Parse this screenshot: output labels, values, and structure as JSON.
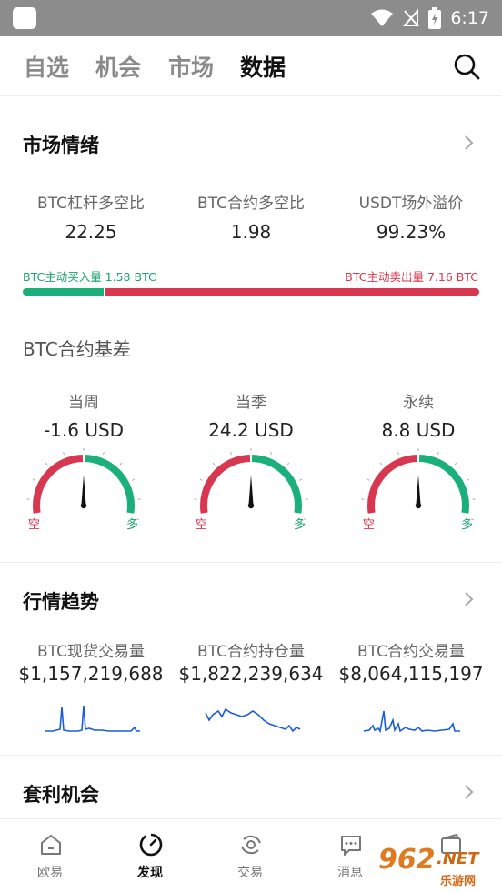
{
  "status_bar": {
    "time": "6:17"
  },
  "top_tabs": [
    {
      "label": "自选"
    },
    {
      "label": "机会"
    },
    {
      "label": "市场"
    },
    {
      "label": "数据"
    }
  ],
  "sentiment": {
    "title": "市场情绪",
    "stats": [
      {
        "label": "BTC杠杆多空比",
        "value": "22.25"
      },
      {
        "label": "BTC合约多空比",
        "value": "1.98"
      },
      {
        "label": "USDT场外溢价",
        "value": "99.23%"
      }
    ],
    "buy_text": "BTC主动买入量 1.58 BTC",
    "sell_text": "BTC主动卖出量 7.16 BTC",
    "buy_amount": 1.58,
    "sell_amount": 7.16
  },
  "basis": {
    "title": "BTC合约基差",
    "short_label": "空",
    "long_label": "多",
    "gauges": [
      {
        "label": "当周",
        "value": "-1.6 USD",
        "needle_fraction": 0.5
      },
      {
        "label": "当季",
        "value": "24.2 USD",
        "needle_fraction": 0.5
      },
      {
        "label": "永续",
        "value": "8.8 USD",
        "needle_fraction": 0.5
      }
    ],
    "colors": {
      "short": "#d8384f",
      "long": "#1bb07a"
    }
  },
  "trend": {
    "title": "行情趋势",
    "items": [
      {
        "label": "BTC现货交易量",
        "value": "$1,157,219,688"
      },
      {
        "label": "BTC合约持仓量",
        "value": "$1,822,239,634"
      },
      {
        "label": "BTC合约交易量",
        "value": "$8,064,115,197"
      }
    ]
  },
  "arbitrage": {
    "title": "套利机会"
  },
  "bottom_nav": [
    {
      "label": "欧易",
      "icon": "home-icon"
    },
    {
      "label": "发现",
      "icon": "discover-icon"
    },
    {
      "label": "交易",
      "icon": "trade-icon"
    },
    {
      "label": "消息",
      "icon": "message-icon"
    },
    {
      "label": "",
      "icon": "wallet-icon"
    }
  ],
  "watermark": {
    "logo": "962",
    "domain": ".NET",
    "text": "乐游网"
  }
}
